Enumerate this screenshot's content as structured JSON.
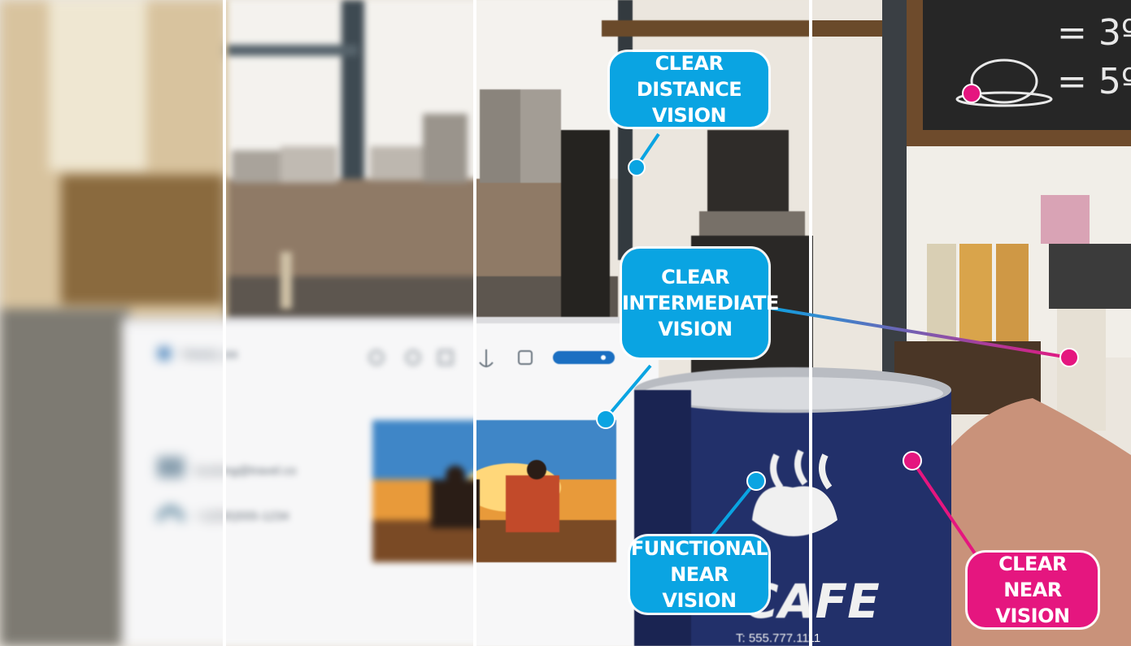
{
  "mockup": {
    "brand": "TRAVEL.XX",
    "email": "booking@travel.co",
    "phone": "+1(555)555-1234",
    "search_icon": "magnifier-icon",
    "nav_icons": [
      "home-icon",
      "pin-icon",
      "bed-icon",
      "anchor-icon",
      "bus-icon"
    ]
  },
  "mug": {
    "brand": "CAFE",
    "phone": "T: 555.777.1111"
  },
  "chalkboard": {
    "prices": [
      "= 3º",
      "= 5º"
    ]
  },
  "callouts": {
    "distance": [
      "CLEAR",
      "DISTANCE VISION"
    ],
    "intermediate": [
      "CLEAR",
      "INTERMEDIATE",
      "VISION"
    ],
    "functional": [
      "FUNCTIONAL",
      "NEAR VISION"
    ],
    "near": [
      "CLEAR",
      "NEAR VISION"
    ]
  },
  "colors": {
    "blue": "#0aa4e2",
    "pink": "#e5167f",
    "mug": "#22306a"
  }
}
